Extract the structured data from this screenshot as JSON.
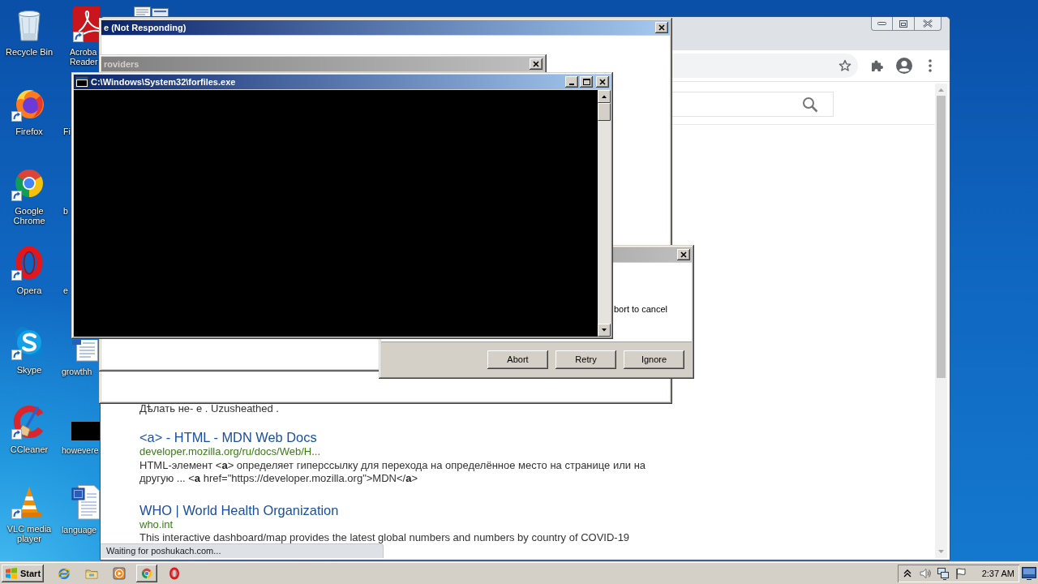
{
  "desktop": {
    "icons": [
      {
        "label": "Recycle Bin",
        "kind": "recycle-bin"
      },
      {
        "label": "Firefox",
        "kind": "firefox"
      },
      {
        "label": "Google Chrome",
        "kind": "chrome"
      },
      {
        "label": "Opera",
        "kind": "opera"
      },
      {
        "label": "Skype",
        "kind": "skype"
      },
      {
        "label": "CCleaner",
        "kind": "ccleaner"
      },
      {
        "label": "VLC media player",
        "kind": "vlc"
      }
    ],
    "covered_icons": [
      {
        "label": "Acroba Reader",
        "kind": "acrobat"
      },
      {
        "label": "Fi",
        "kind": "hidden"
      },
      {
        "label": "b",
        "kind": "hidden"
      },
      {
        "label": "e",
        "kind": "hidden"
      },
      {
        "label": "growthh",
        "kind": "document"
      },
      {
        "label": "howevere",
        "kind": "thumbnail"
      },
      {
        "label": "language",
        "kind": "word-document"
      }
    ]
  },
  "browser": {
    "results": [
      {
        "snippet": "Дѣлать не- е . Uzusheathed ."
      },
      {
        "title": "<a> - HTML - MDN Web Docs",
        "url": "developer.mozilla.org/ru/docs/Web/H...",
        "snippet": "HTML-элемент <**a**> определяет гиперссылку для перехода на определённое место на странице или на другую ... <**a** href=\"https://developer.mozilla.org\">MDN</**a**>"
      },
      {
        "title": "WHO | World Health Organization",
        "url": "who.int",
        "snippet": "This interactive dashboard/map provides the latest global numbers and numbers by country of COVID-19"
      }
    ],
    "status": "Waiting for poshukach.com..."
  },
  "windows": [
    {
      "kind": "blank",
      "title": "e (Not Responding)",
      "active": true
    },
    {
      "kind": "blank",
      "title": "roviders",
      "active": false
    },
    {
      "kind": "dialog",
      "active": false,
      "message": "bort to cancel",
      "buttons": [
        "Abort",
        "Retry",
        "Ignore"
      ]
    },
    {
      "kind": "console",
      "title": "C:\\Windows\\System32\\forfiles.exe",
      "active": true
    }
  ],
  "taskbar": {
    "start": "Start",
    "buttons": [
      {
        "running": false
      },
      {
        "running": false
      },
      {
        "running": false
      },
      {
        "running": true
      },
      {
        "running": false
      }
    ],
    "clock": "2:37 AM"
  }
}
